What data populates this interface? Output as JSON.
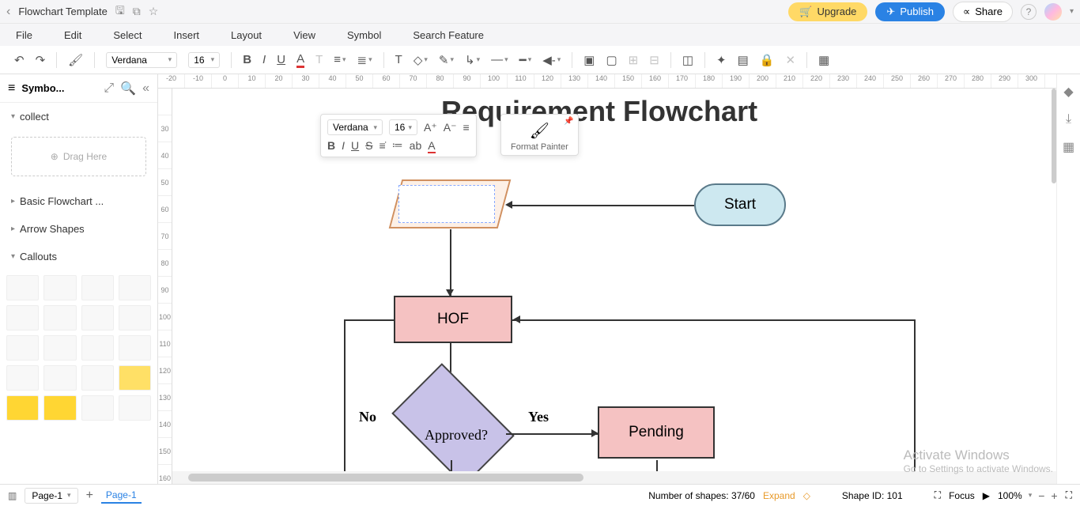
{
  "titlebar": {
    "title": "Flowchart Template",
    "upgrade": "Upgrade",
    "publish": "Publish",
    "share": "Share"
  },
  "menubar": {
    "file": "File",
    "edit": "Edit",
    "select": "Select",
    "insert": "Insert",
    "layout": "Layout",
    "view": "View",
    "symbol": "Symbol",
    "search": "Search Feature"
  },
  "toolbar": {
    "font": "Verdana",
    "size": "16"
  },
  "sidebar": {
    "label": "Symbo...",
    "sections": {
      "collect": "collect",
      "drag": "Drag Here",
      "basic": "Basic Flowchart ...",
      "arrow": "Arrow Shapes",
      "callouts": "Callouts"
    }
  },
  "ruler_h": [
    "-20",
    "-10",
    "0",
    "10",
    "20",
    "30",
    "40",
    "50",
    "60",
    "70",
    "80",
    "90",
    "100",
    "110",
    "120",
    "130",
    "140",
    "150",
    "160",
    "170",
    "180",
    "190",
    "200",
    "210",
    "220",
    "230",
    "240",
    "250",
    "260",
    "270",
    "280",
    "290",
    "300"
  ],
  "ruler_v": [
    "",
    "30",
    "40",
    "50",
    "60",
    "70",
    "80",
    "90",
    "100",
    "110",
    "120",
    "130",
    "140",
    "150",
    "160"
  ],
  "float_toolbar": {
    "font": "Verdana",
    "size": "16",
    "fp_label": "Format Painter"
  },
  "flowchart": {
    "title": "Requirement Flowchart",
    "start": "Start",
    "hof": "HOF",
    "approved": "Approved?",
    "pending": "Pending",
    "no": "No",
    "yes": "Yes"
  },
  "statusbar": {
    "page_selector": "Page-1",
    "page_tab": "Page-1",
    "shapes_label": "Number of shapes: ",
    "shapes_count": "37/60",
    "expand": "Expand",
    "shape_id_label": "Shape ID: ",
    "shape_id": "101",
    "focus": "Focus",
    "zoom": "100%"
  },
  "watermark": {
    "line1": "Activate Windows",
    "line2": "Go to Settings to activate Windows."
  }
}
